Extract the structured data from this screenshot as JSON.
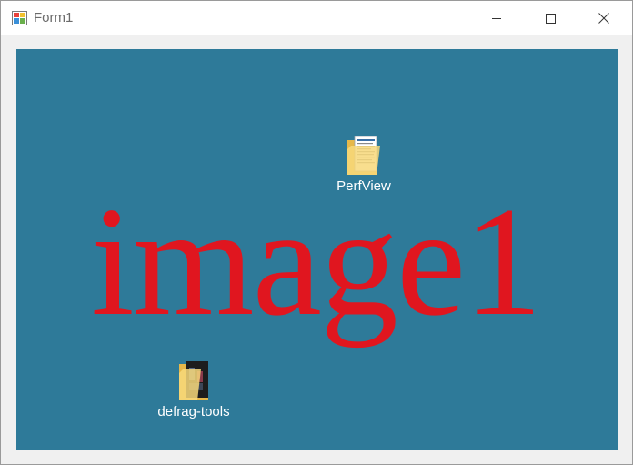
{
  "window": {
    "title": "Form1",
    "icon": "winforms-app-icon",
    "controls": {
      "minimize": "minimize-icon",
      "maximize": "maximize-icon",
      "close": "close-icon"
    }
  },
  "picture_box": {
    "background": "#2e7a99",
    "overlay_text": "image1",
    "overlay_color": "#e0161f",
    "items": [
      {
        "label": "PerfView",
        "icon": "folder-icon"
      },
      {
        "label": "defrag-tools",
        "icon": "folder-icon"
      }
    ]
  }
}
